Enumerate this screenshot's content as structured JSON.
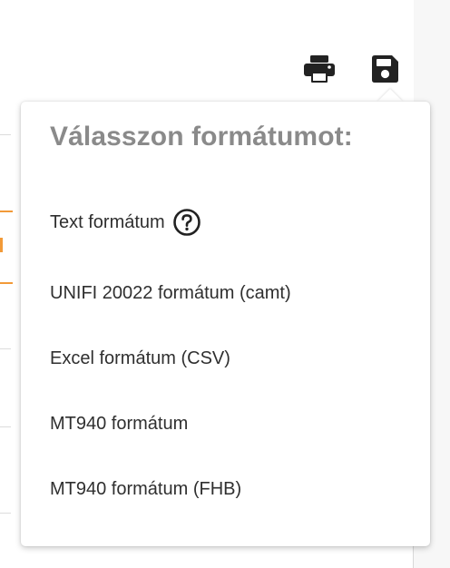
{
  "toolbar": {
    "print_icon": "printer-icon",
    "save_icon": "floppy-disk-icon"
  },
  "format_menu": {
    "title": "Válasszon formátumot:",
    "options": [
      {
        "label": "Text formátum",
        "icon": "help-circle-icon"
      },
      {
        "label": "UNIFI 20022 formátum (camt)"
      },
      {
        "label": "Excel formátum (CSV)"
      },
      {
        "label": "MT940 formátum"
      },
      {
        "label": "MT940 formátum (FHB)"
      }
    ]
  },
  "colors": {
    "accent": "#f29a38",
    "icon": "#222222",
    "title": "#8a8a8a",
    "text": "#2f2f2f"
  }
}
